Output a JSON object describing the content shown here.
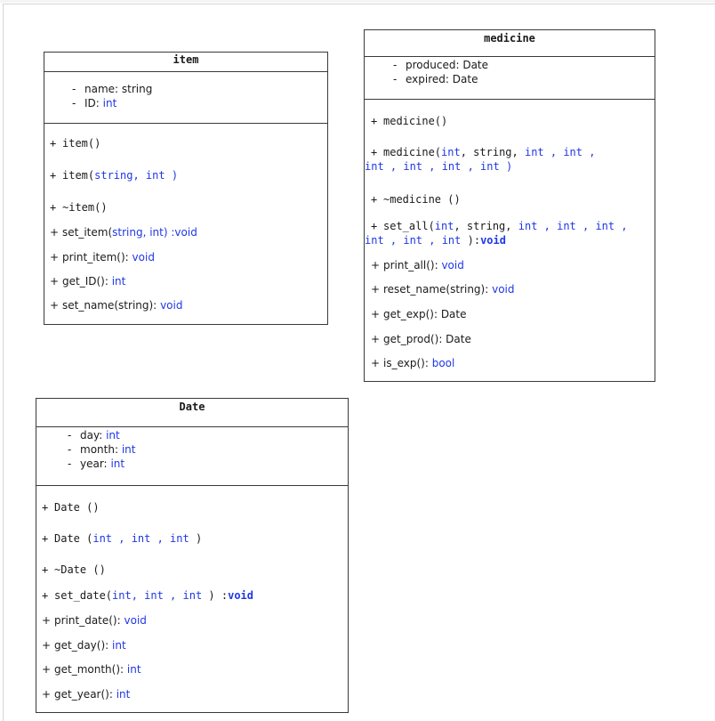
{
  "classes": {
    "item": {
      "name": "item",
      "attributes": [
        {
          "vis": "-",
          "name": "name:",
          "type": "string"
        },
        {
          "vis": "-",
          "name": "ID:",
          "type": "int"
        }
      ],
      "methods": {
        "ctor": "item()",
        "ctor2_name": "item(",
        "ctor2_params": "string, int )",
        "dtor": "~item()",
        "set_item_name": "set_item(",
        "set_item_params": "string, int)",
        "set_item_ret": ":void",
        "print_item": "print_item():",
        "print_item_ret": "void",
        "get_ID": "get_ID():",
        "get_ID_ret": "int",
        "set_name": "set_name(string):",
        "set_name_ret": "void"
      }
    },
    "medicine": {
      "name": "medicine",
      "attributes": [
        {
          "vis": "-",
          "name": "produced:",
          "type": "Date"
        },
        {
          "vis": "-",
          "name": "expired:",
          "type": "Date"
        }
      ],
      "methods": {
        "ctor": "medicine()",
        "ctor2_name": "medicine(",
        "ctor2_p1": "int",
        "ctor2_p2": ", string,",
        "ctor2_p3": "int , int ,",
        "ctor2_l2": "int ,  int , int , int",
        "ctor2_close": ")",
        "dtor": "~medicine ()",
        "set_all_name": "set_all(",
        "set_all_p1": "int",
        "set_all_p2": ", string,",
        "set_all_p3": "int , int , int ,",
        "set_all_l2": "int , int , int",
        "set_all_close": "):",
        "set_all_ret": "void",
        "print_all": "print_all():",
        "print_all_ret": "void",
        "reset_name": "reset_name(string):",
        "reset_name_ret": "void",
        "get_exp": "get_exp(): Date",
        "get_prod": "get_prod(): Date",
        "is_exp": "is_exp():",
        "is_exp_ret": "bool"
      }
    },
    "date": {
      "name": "Date",
      "attributes": [
        {
          "vis": "-",
          "name": "day:",
          "type": "int"
        },
        {
          "vis": "-",
          "name": "month:",
          "type": "int"
        },
        {
          "vis": "-",
          "name": "year:",
          "type": "int"
        }
      ],
      "methods": {
        "ctor": "Date ()",
        "ctor2_name": "Date (",
        "ctor2_params": "int , int , int",
        "ctor2_close": ")",
        "dtor": "~Date ()",
        "set_date_name": "set_date(",
        "set_date_params": "int,  int , int",
        "set_date_close": ") :",
        "set_date_ret": "void",
        "print_date": "print_date():",
        "print_date_ret": "void",
        "get_day": "get_day():",
        "get_day_ret": "int",
        "get_month": "get_month():",
        "get_month_ret": "int",
        "get_year": "get_year():",
        "get_year_ret": "int"
      }
    }
  },
  "symbols": {
    "plus": "+",
    "minus": "-"
  },
  "colors": {
    "keyword": "#1f37e6",
    "border": "#3a3a3a",
    "text": "#1a1a1a"
  }
}
